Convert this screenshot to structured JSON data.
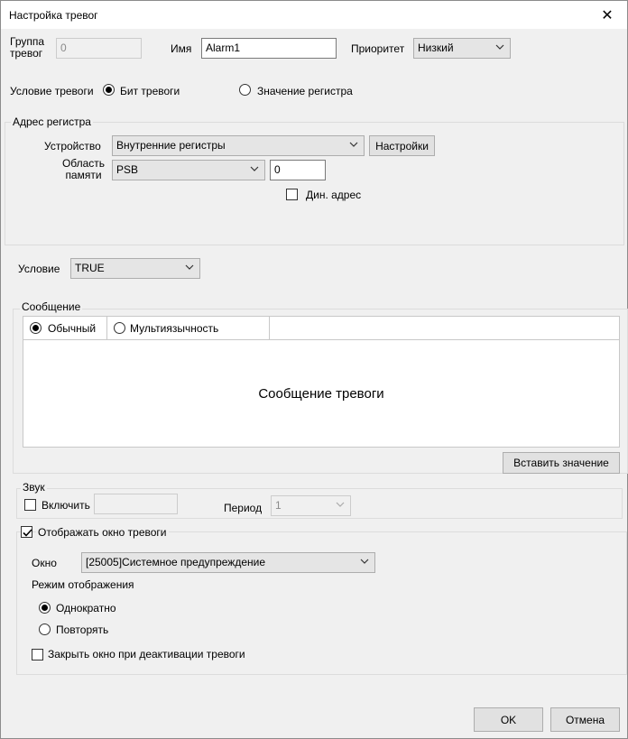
{
  "dialog": {
    "title": "Настройка тревог",
    "close_symbol": "✕"
  },
  "top": {
    "group_label": "Группа тревог",
    "group_value": "0",
    "name_label": "Имя",
    "name_value": "Alarm1",
    "priority_label": "Приоритет",
    "priority_value": "Низкий"
  },
  "alarm_condition": {
    "label": "Условие тревоги",
    "options": [
      "Бит тревоги",
      "Значение регистра"
    ],
    "selected": "Бит тревоги"
  },
  "register_address": {
    "title": "Адрес регистра",
    "device_label": "Устройство",
    "device_value": "Внутренние регистры",
    "settings_button": "Настройки",
    "memory_label": "Область памяти",
    "memory_value": "PSB",
    "address_value": "0",
    "dyn_address_label": "Дин. адрес",
    "dyn_address_checked": false
  },
  "condition": {
    "label": "Условие",
    "value": "TRUE"
  },
  "message": {
    "title": "Сообщение",
    "tabs": [
      "Обычный",
      "Мультиязычность"
    ],
    "selected_tab": "Обычный",
    "text": "Сообщение тревоги",
    "insert_button": "Вставить значение"
  },
  "sound": {
    "title": "Звук",
    "enable_label": "Включить",
    "enabled": false,
    "sound_value": "",
    "period_label": "Период",
    "period_value": "1"
  },
  "alarm_window": {
    "show_label": "Отображать окно тревоги",
    "show_checked": true,
    "window_label": "Окно",
    "window_value": "[25005]Системное предупреждение",
    "display_mode_label": "Режим отображения",
    "modes": [
      "Однократно",
      "Повторять"
    ],
    "selected_mode": "Однократно",
    "close_on_deactivate_label": "Закрыть окно при деактивации тревоги",
    "close_on_deactivate_checked": false
  },
  "footer": {
    "ok_button": "OK",
    "cancel_button": "Отмена"
  }
}
